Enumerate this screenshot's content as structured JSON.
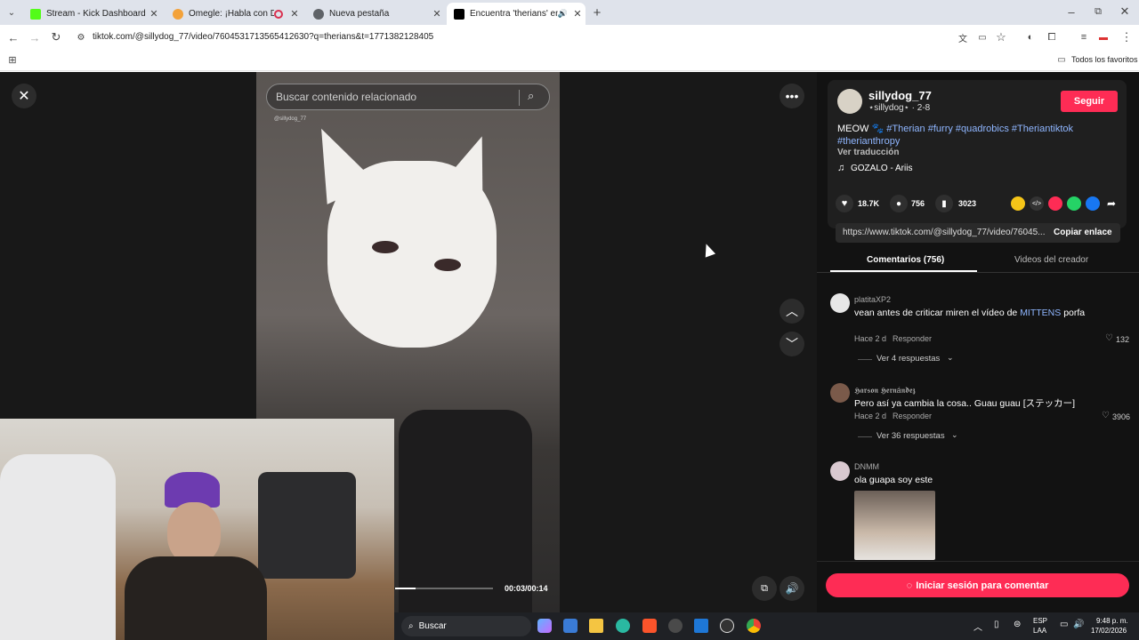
{
  "browser": {
    "tabs": [
      {
        "title": "Stream - Kick Dashboard",
        "favicon_color": "#53fc18"
      },
      {
        "title": "Omegle: ¡Habla con Descor",
        "favicon_color": "#f3a23a"
      },
      {
        "title": "Nueva pestaña",
        "favicon_color": "#5f6368"
      },
      {
        "title": "Encuentra 'therians' en TikT",
        "favicon_color": "#000000"
      }
    ],
    "new_tab": "+",
    "url": "tiktok.com/@sillydog_77/video/7604531713565412630?q=therians&t=1771382128405",
    "bookmarks_label": "Todos los favoritos"
  },
  "player": {
    "search_placeholder": "Buscar contenido relacionado",
    "watermark": "@sillydog_77",
    "time": "00:03/00:14",
    "progress": 0.21
  },
  "profile": {
    "username": "sillydog_77",
    "handle": "⋆sillydog⋆ · 2-8",
    "follow": "Seguir",
    "caption_text": "MEOW 🐾 ",
    "hashtags": [
      "#Therian",
      "#furry",
      "#quadrobics",
      "#Theriantiktok",
      "#therianthropy"
    ],
    "translate": "Ver traducción",
    "music": "GOZALO - Ariis"
  },
  "stats": {
    "likes": "18.7K",
    "comments": "756",
    "saves": "3023"
  },
  "share": {
    "link": "https://www.tiktok.com/@sillydog_77/video/76045...",
    "copy": "Copiar enlace"
  },
  "tabs": {
    "comments": "Comentarios (756)",
    "creator": "Videos del creador"
  },
  "comments": [
    {
      "user": "platitaXP2",
      "text_a": "vean antes de criticar miren el vídeo de ",
      "mention": "MITTENS",
      "text_b": " porfa",
      "time": "Hace 2 d",
      "reply": "Responder",
      "likes": "132",
      "replies": "Ver 4 respuestas"
    },
    {
      "user": "𝕳𝖆𝖗𝖘𝖔𝖓 𝕳𝖊𝖗𝖓á𝖓𝖉𝖊𝖟",
      "text": "Pero así ya cambia la cosa.. Guau guau [ステッカー]",
      "time": "Hace 2 d",
      "reply": "Responder",
      "likes": "3906",
      "replies": "Ver 36 respuestas"
    },
    {
      "user": "DNMM",
      "text": "ola guapa soy este"
    }
  ],
  "login_button": "Iniciar sesión para comentar",
  "taskbar": {
    "search": "Buscar",
    "lang1": "ESP",
    "lang2": "LAA",
    "time": "9:48 p. m.",
    "date": "17/02/2026"
  }
}
